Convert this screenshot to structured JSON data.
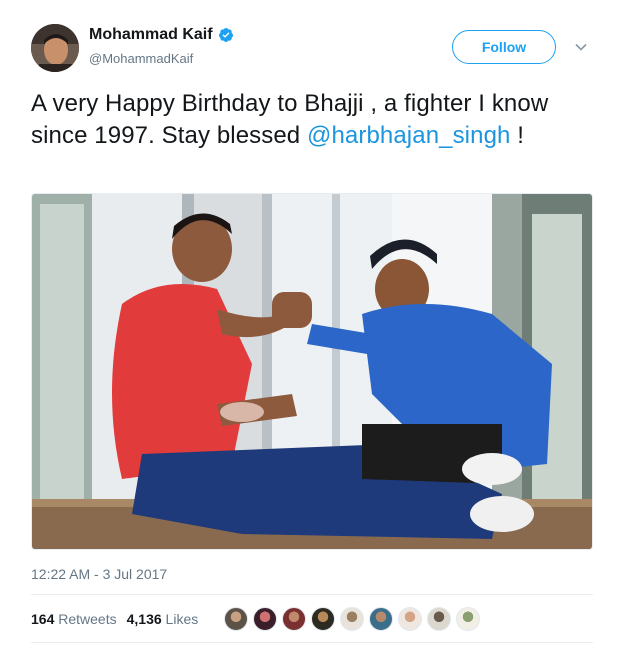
{
  "author": {
    "display_name": "Mohammad Kaif",
    "handle": "@MohammadKaif",
    "verified_icon": "verified-badge-icon"
  },
  "follow_button": {
    "label": "Follow"
  },
  "tweet": {
    "text_part1": "A very Happy Birthday to Bhajji , a fighter I know since 1997. Stay blessed ",
    "mention": "@harbhajan_singh",
    "text_part2": " !"
  },
  "timestamp": "12:22 AM - 3 Jul 2017",
  "stats": {
    "retweets_count": "164",
    "retweets_label": "Retweets",
    "likes_count": "4,136",
    "likes_label": "Likes"
  },
  "colors": {
    "accent": "#1da1f2",
    "mention": "#1b95e0",
    "muted_text": "#657786",
    "divider": "#e6ecf0"
  }
}
